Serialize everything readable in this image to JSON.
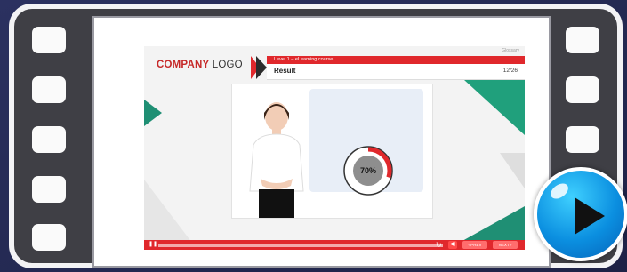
{
  "slide": {
    "logo_bold": "COMPANY",
    "logo_rest": " LOGO",
    "course": "Level 1 – eLearning course",
    "glossary": "Glossary",
    "title": "Result",
    "page": "12/26",
    "score": "70%",
    "score_fraction": 0.7
  },
  "controls": {
    "prev": "‹ PREV",
    "next": "NEXT ›",
    "progress_fraction": 0.05
  },
  "colors": {
    "accent": "#e0282c",
    "frame": "#3f3f45",
    "play": "#0b8fe0"
  },
  "icons": {
    "play": "play-icon",
    "pause": "pause-icon",
    "replay": "replay-icon",
    "volume": "volume-icon"
  }
}
